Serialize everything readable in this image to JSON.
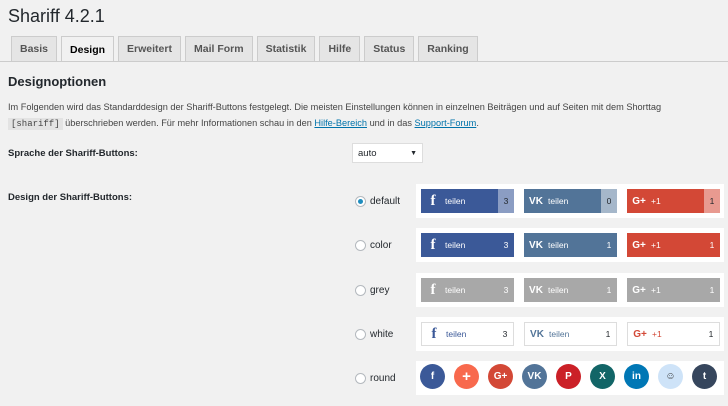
{
  "page_title": "Shariff 4.2.1",
  "tabs": [
    "Basis",
    "Design",
    "Erweitert",
    "Mail Form",
    "Statistik",
    "Hilfe",
    "Status",
    "Ranking"
  ],
  "section_title": "Designoptionen",
  "description": {
    "line1": "Im Folgenden wird das Standarddesign der Shariff-Buttons festgelegt. Die meisten Einstellungen können in einzelnen Beiträgen und auf Seiten mit dem Shorttag",
    "code": "[shariff]",
    "line2a": "überschrieben werden. Für mehr Informationen schau in den",
    "link1": "Hilfe-Bereich",
    "line2b": "und in das",
    "link2": "Support-Forum",
    "line2c": "."
  },
  "language_label": "Sprache der Shariff-Buttons:",
  "language_value": "auto",
  "design_label": "Design der Shariff-Buttons:",
  "design_options": [
    {
      "value": "default",
      "selected": true
    },
    {
      "value": "color",
      "selected": false
    },
    {
      "value": "grey",
      "selected": false
    },
    {
      "value": "white",
      "selected": false
    },
    {
      "value": "round",
      "selected": false
    }
  ],
  "button_labels": {
    "facebook": "teilen",
    "vk": "teilen",
    "gplus": "+1"
  },
  "counts": {
    "default": [
      "3",
      "0",
      "1"
    ],
    "color": [
      "3",
      "1",
      "1"
    ],
    "grey": [
      "3",
      "1",
      "1"
    ],
    "white": [
      "3",
      "1",
      "1"
    ]
  },
  "icons": {
    "facebook": "f",
    "vk": "VK",
    "gplus": "G+"
  },
  "round_icons": [
    {
      "name": "facebook-icon",
      "glyph": "f",
      "color": "#3b5998"
    },
    {
      "name": "addthis-icon",
      "glyph": "+",
      "color": "#f8694d"
    },
    {
      "name": "googleplus-icon",
      "glyph": "G+",
      "color": "#d34836"
    },
    {
      "name": "vk-icon",
      "glyph": "VK",
      "color": "#527498"
    },
    {
      "name": "pinterest-icon",
      "glyph": "P",
      "color": "#cb2027"
    },
    {
      "name": "xing-icon",
      "glyph": "X",
      "color": "#126567"
    },
    {
      "name": "linkedin-icon",
      "glyph": "in",
      "color": "#0077b5"
    },
    {
      "name": "reddit-icon",
      "glyph": "☺",
      "color": "#cee3f8"
    },
    {
      "name": "tumblr-icon",
      "glyph": "t",
      "color": "#36465d"
    }
  ],
  "colors": {
    "facebook": "#3b5998",
    "facebook_dark": "#2d4373",
    "vk": "#527498",
    "vk_dark": "#3d5a7a",
    "gplus": "#d34836",
    "grey": "#a8a8a8",
    "link": "#0073aa"
  }
}
